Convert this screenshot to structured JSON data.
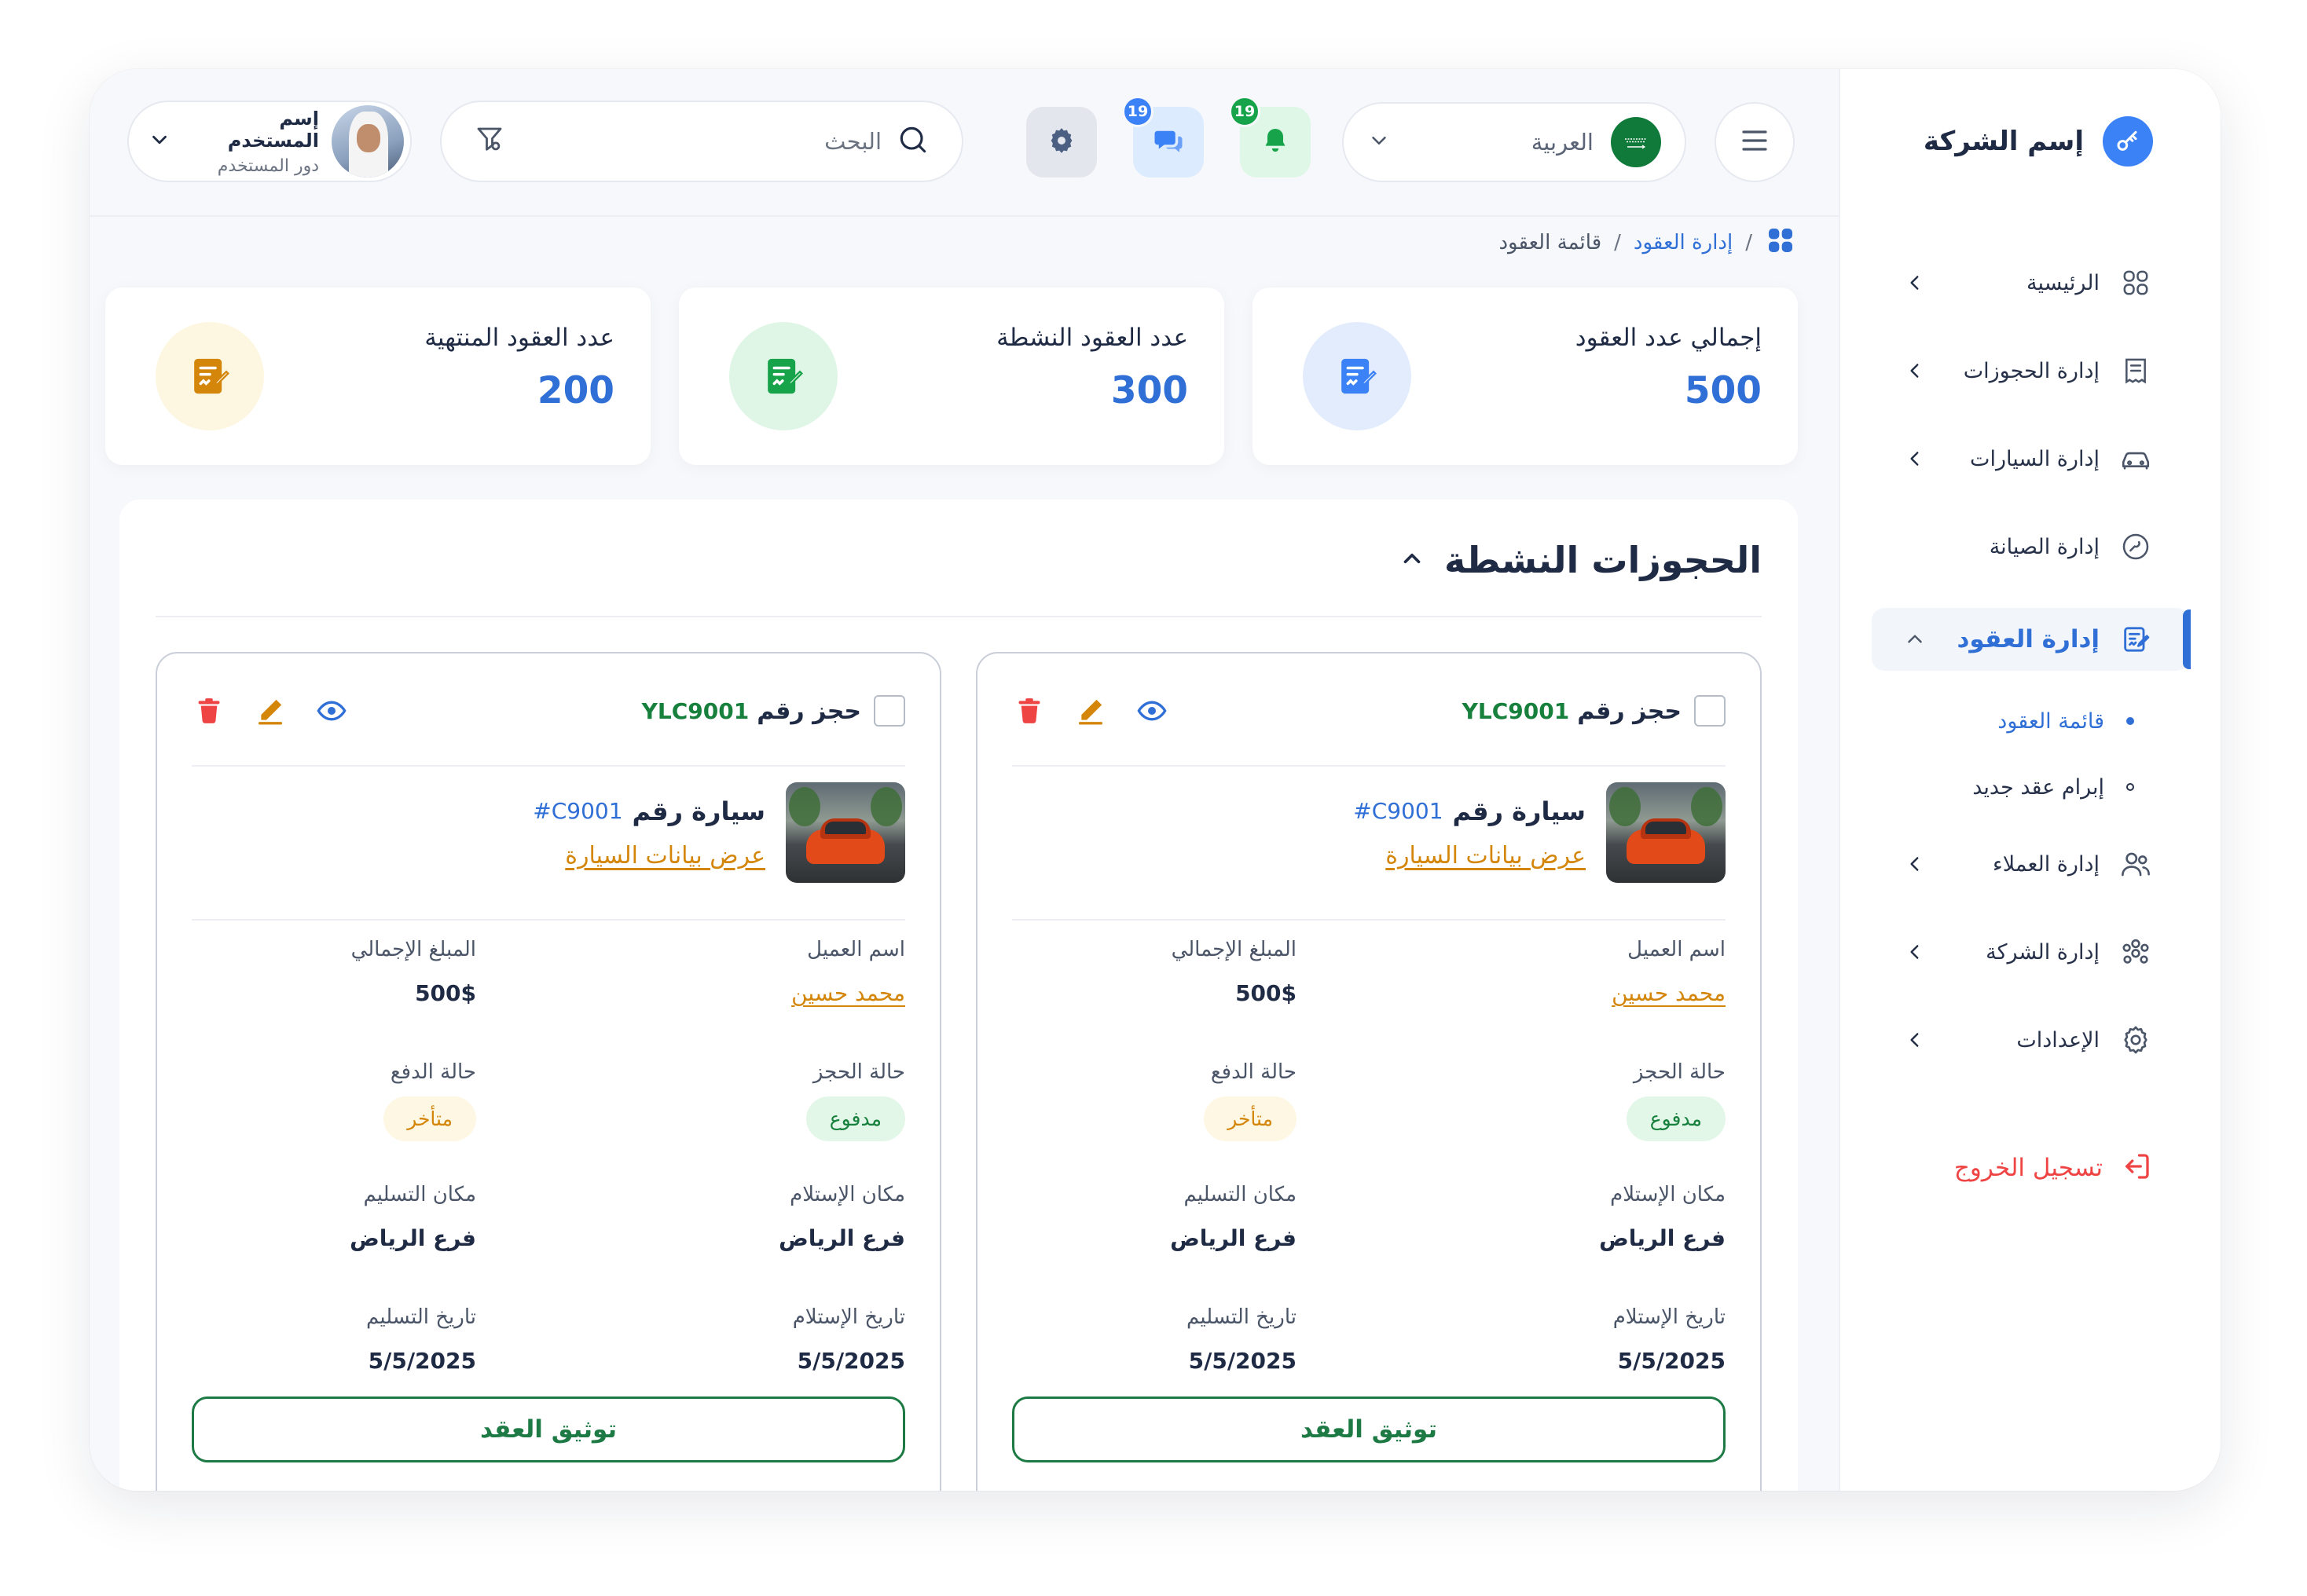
{
  "sidebar": {
    "company_name": "إسم الشركة",
    "items": [
      {
        "label": "الرئيسية",
        "icon": "grid-icon"
      },
      {
        "label": "إدارة الحجوزات",
        "icon": "receipt-icon"
      },
      {
        "label": "إدارة السيارات",
        "icon": "car-icon"
      },
      {
        "label": "إدارة الصيانة",
        "icon": "wrench-icon"
      },
      {
        "label": "إدارة العقود",
        "icon": "contract-icon",
        "active": true
      },
      {
        "label": "إدارة العملاء",
        "icon": "users-icon"
      },
      {
        "label": "إدارة الشركة",
        "icon": "company-icon"
      },
      {
        "label": "الإعدادات",
        "icon": "gear-icon"
      }
    ],
    "subitems": [
      {
        "label": "قائمة العقود",
        "active": true
      },
      {
        "label": "إبرام عقد جديد",
        "active": false
      }
    ],
    "logout_label": "تسجيل الخروج"
  },
  "header": {
    "language": "العربية",
    "notifications_count": "19",
    "messages_count": "19",
    "search_placeholder": "البحث",
    "user_name": "إسم المستخدم",
    "user_role": "دور المستخدم"
  },
  "breadcrumb": {
    "parent": "إدارة العقود",
    "separator": "/",
    "current": "قائمة العقود"
  },
  "stats": [
    {
      "label": "إجمالي عدد العقود",
      "value": "500",
      "icon": "contract-icon",
      "color": "#3b82f6"
    },
    {
      "label": "عدد العقود النشطة",
      "value": "300",
      "icon": "contract-check-icon",
      "color": "#16a34a"
    },
    {
      "label": "عدد العقود المنتهية",
      "value": "200",
      "icon": "contract-ended-icon",
      "color": "#d4860b"
    }
  ],
  "panel": {
    "title": "الحجوزات النشطة"
  },
  "cards": [
    {
      "reservation_label": "حجز رقم",
      "reservation_id": "YLC9001",
      "car_label": "سيارة رقم",
      "car_id": "#C9001",
      "car_link": "عرض بيانات السيارة",
      "customer_label": "اسم العميل",
      "customer_name": "محمد حسين",
      "total_label": "المبلغ الإجمالي",
      "total_value": "500$",
      "booking_status_label": "حالة الحجز",
      "booking_status": "مدفوع",
      "payment_status_label": "حالة الدفع",
      "payment_status": "متأخر",
      "pickup_place_label": "مكان الإستلام",
      "pickup_place": "فرع الرياض",
      "delivery_place_label": "مكان التسليم",
      "delivery_place": "فرع الرياض",
      "pickup_date_label": "تاريخ الإستلام",
      "pickup_date": "5/5/2025",
      "delivery_date_label": "تاريخ التسليم",
      "delivery_date": "5/5/2025",
      "action_label": "توثيق العقد"
    },
    {
      "reservation_label": "حجز رقم",
      "reservation_id": "YLC9001",
      "car_label": "سيارة رقم",
      "car_id": "#C9001",
      "car_link": "عرض بيانات السيارة",
      "customer_label": "اسم العميل",
      "customer_name": "محمد حسين",
      "total_label": "المبلغ الإجمالي",
      "total_value": "500$",
      "booking_status_label": "حالة الحجز",
      "booking_status": "مدفوع",
      "payment_status_label": "حالة الدفع",
      "payment_status": "متأخر",
      "pickup_place_label": "مكان الإستلام",
      "pickup_place": "فرع الرياض",
      "delivery_place_label": "مكان التسليم",
      "delivery_place": "فرع الرياض",
      "pickup_date_label": "تاريخ الإستلام",
      "pickup_date": "5/5/2025",
      "delivery_date_label": "تاريخ التسليم",
      "delivery_date": "5/5/2025",
      "action_label": "توثيق العقد"
    }
  ]
}
